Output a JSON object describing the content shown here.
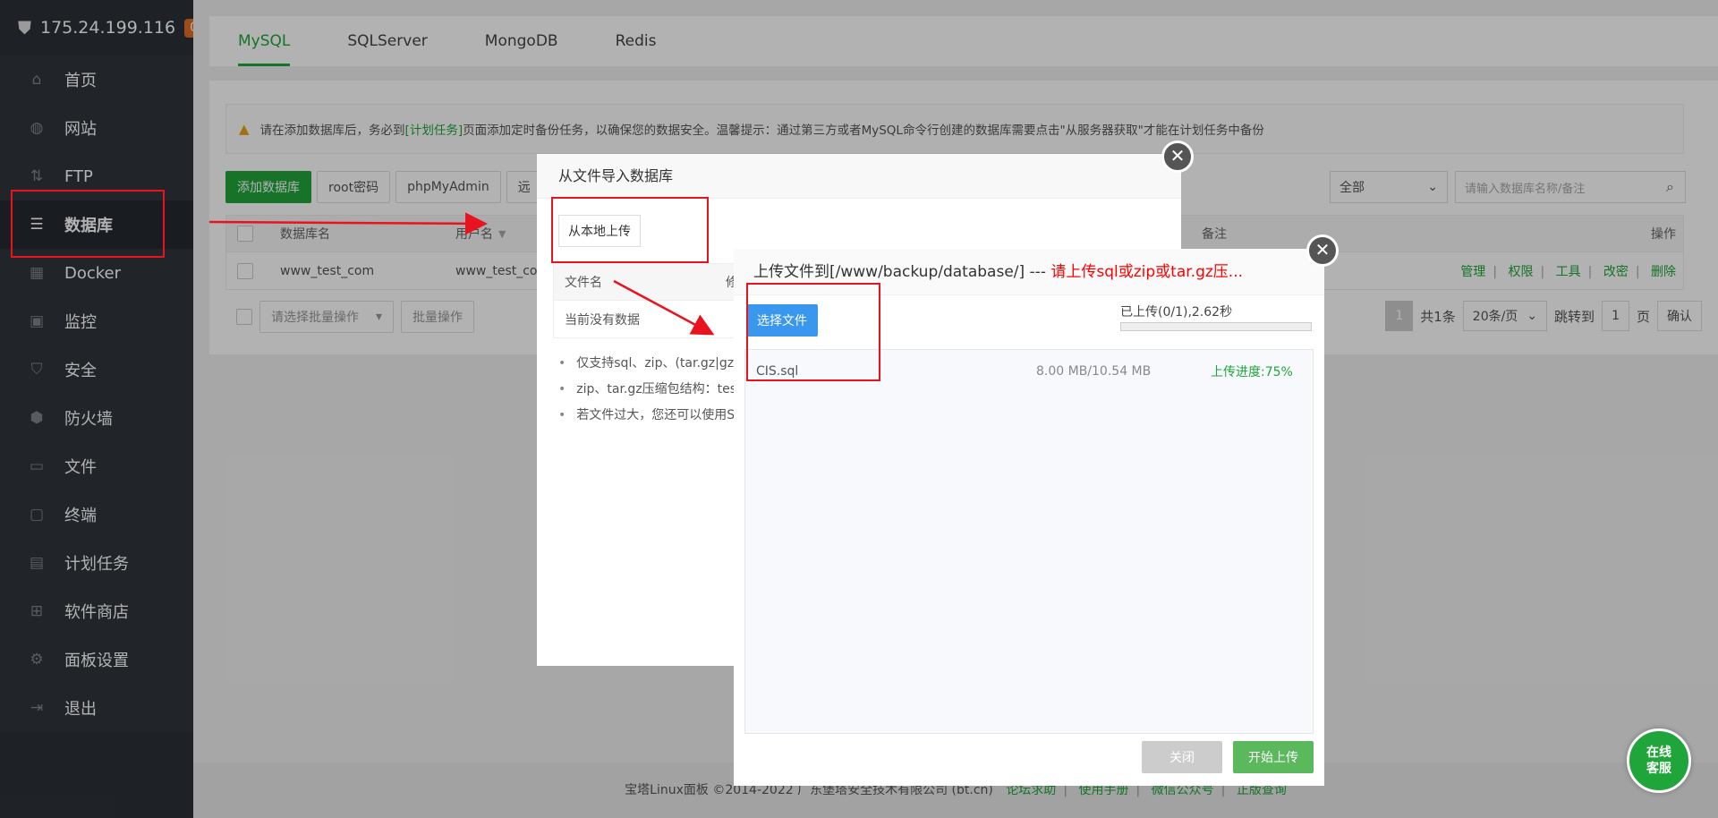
{
  "sidebar": {
    "server_ip": "175.24.199.116",
    "badge": "0",
    "items": [
      {
        "label": "首页",
        "icon": "home-icon"
      },
      {
        "label": "网站",
        "icon": "globe-icon"
      },
      {
        "label": "FTP",
        "icon": "ftp-icon"
      },
      {
        "label": "数据库",
        "icon": "database-icon"
      },
      {
        "label": "Docker",
        "icon": "docker-icon"
      },
      {
        "label": "监控",
        "icon": "monitor-icon"
      },
      {
        "label": "安全",
        "icon": "shield-icon"
      },
      {
        "label": "防火墙",
        "icon": "firewall-icon"
      },
      {
        "label": "文件",
        "icon": "folder-icon"
      },
      {
        "label": "终端",
        "icon": "terminal-icon"
      },
      {
        "label": "计划任务",
        "icon": "calendar-icon"
      },
      {
        "label": "软件商店",
        "icon": "apps-icon"
      },
      {
        "label": "面板设置",
        "icon": "gear-icon"
      },
      {
        "label": "退出",
        "icon": "logout-icon"
      }
    ]
  },
  "tabs": [
    "MySQL",
    "SQLServer",
    "MongoDB",
    "Redis"
  ],
  "tip": {
    "before": "请在添加数据库后，务必到",
    "link": "[计划任务]",
    "after": "页面添加定时备份任务，以确保您的数据安全。温馨提示：通过第三方或者MySQL命令行创建的数据库需要点击\"从服务器获取\"才能在计划任务中备份"
  },
  "toolbar": {
    "add_db": "添加数据库",
    "root_pwd": "root密码",
    "phpmyadmin": "phpMyAdmin",
    "more": "远"
  },
  "filter": {
    "selected": "全部",
    "search_placeholder": "请输入数据库名称/备注"
  },
  "table": {
    "headers": {
      "name": "数据库名",
      "user": "用户名",
      "note": "备注",
      "ops": "操作"
    },
    "row": {
      "name": "www_test_com",
      "user": "www_test_com"
    },
    "ops": [
      "管理",
      "权限",
      "工具",
      "改密",
      "删除"
    ]
  },
  "batch": {
    "placeholder": "请选择批量操作",
    "button": "批量操作"
  },
  "pager": {
    "current": "1",
    "total": "共1条",
    "per_page": "20条/页",
    "goto": "跳转到",
    "page_value": "1",
    "page_unit": "页",
    "confirm": "确认"
  },
  "footer": {
    "copyright": "宝塔Linux面板 ©2014-2022 广东堡塔安全技术有限公司 (bt.cn)",
    "links": [
      "论坛求助",
      "使用手册",
      "微信公众号",
      "正版查询"
    ]
  },
  "dialog1": {
    "title": "从文件导入数据库",
    "upload_local": "从本地上传",
    "col_file": "文件名",
    "col_mod": "修",
    "empty": "当前没有数据",
    "notes": [
      "仅支持sql、zip、(tar.gz|gz|t",
      "zip、tar.gz压缩包结构：test",
      "若文件过大，您还可以使用S"
    ]
  },
  "dialog2": {
    "title_prefix": "上传文件到[/www/backup/database/] --- ",
    "title_red": "请上传sql或zip或tar.gz压...",
    "choose_file": "选择文件",
    "progress_text": "已上传(0/1),2.62秒",
    "progress_fraction": 0.0,
    "file": {
      "name": "CIS.sql",
      "size": "8.00 MB/10.54 MB",
      "progress": "上传进度:75%"
    },
    "btn_close": "关闭",
    "btn_start": "开始上传"
  },
  "chat": {
    "label": "在线客服"
  },
  "colors": {
    "brand": "#20a53a",
    "annotation": "#e8131f",
    "sidebar": "#2c3138"
  }
}
